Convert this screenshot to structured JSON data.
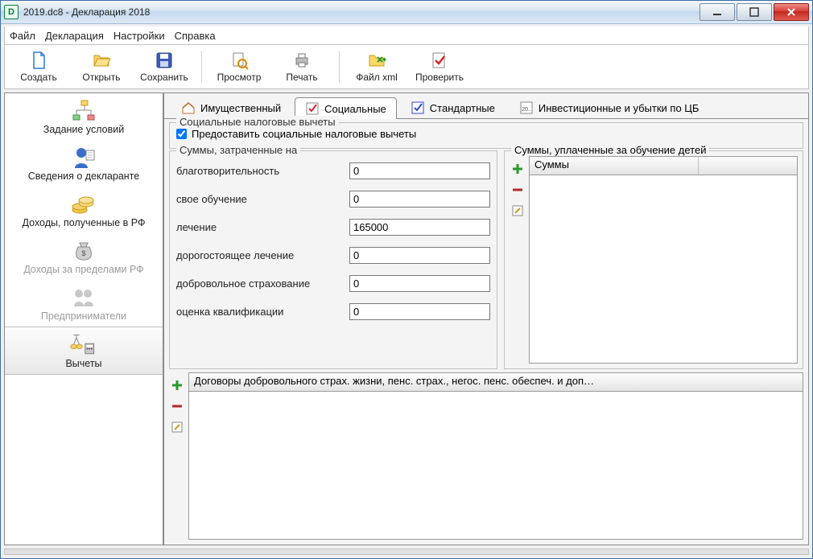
{
  "window": {
    "title": "2019.dc8 - Декларация 2018"
  },
  "menu": {
    "file": "Файл",
    "declaration": "Декларация",
    "settings": "Настройки",
    "help": "Справка"
  },
  "toolbar": {
    "create": "Создать",
    "open": "Открыть",
    "save": "Сохранить",
    "preview": "Просмотр",
    "print": "Печать",
    "filexml": "Файл xml",
    "check": "Проверить"
  },
  "sidebar": {
    "items": [
      {
        "label": "Задание условий"
      },
      {
        "label": "Сведения о декларанте"
      },
      {
        "label": "Доходы, полученные в РФ"
      },
      {
        "label": "Доходы за пределами РФ"
      },
      {
        "label": "Предприниматели"
      },
      {
        "label": "Вычеты"
      }
    ]
  },
  "tabs": {
    "property": "Имущественный",
    "social": "Социальные",
    "standard": "Стандартные",
    "investment": "Инвестиционные и убытки по ЦБ"
  },
  "social_panel": {
    "group_title": "Социальные налоговые вычеты",
    "provide_checkbox": "Предоставить социальные налоговые вычеты",
    "sums_title": "Суммы, затраченные на",
    "fields": {
      "charity_label": "благотворительность",
      "charity_value": "0",
      "own_education_label": "свое обучение",
      "own_education_value": "0",
      "treatment_label": "лечение",
      "treatment_value": "165000",
      "expensive_treatment_label": "дорогостоящее лечение",
      "expensive_treatment_value": "0",
      "voluntary_insurance_label": "добровольное страхование",
      "voluntary_insurance_value": "0",
      "qualification_label": "оценка квалификации",
      "qualification_value": "0"
    },
    "children_education_title": "Суммы, уплаченные за обучение детей",
    "children_col_header": "Суммы",
    "contracts_header": "Договоры добровольного страх. жизни, пенс. страх., негос. пенс. обеспеч. и доп…"
  }
}
